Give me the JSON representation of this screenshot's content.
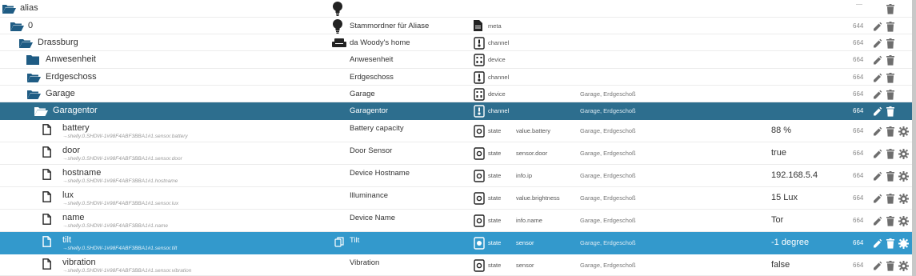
{
  "colors": {
    "selected_dark": "#2d6e8e",
    "selected_blue": "#3399cc",
    "folder": "#1f5c84"
  },
  "rows": [
    {
      "id": "alias",
      "name": "alias",
      "type_icon": "",
      "indent": 0,
      "kind": "folder-open",
      "cname": "",
      "ctype": "",
      "ctype_icon": "",
      "role": "",
      "room": "",
      "value": "",
      "acl": "",
      "actions": [
        "dash",
        "delete"
      ],
      "show_bulb": true
    },
    {
      "id": "0",
      "name": "0",
      "indent": 1,
      "kind": "folder-open",
      "cname": "Stammordner für Aliase",
      "ctype": "meta",
      "ctype_icon": "document-icon",
      "role": "",
      "room": "",
      "value": "",
      "acl": "644",
      "actions": [
        "edit",
        "delete"
      ],
      "show_bulb": true
    },
    {
      "id": "drassburg",
      "name": "Drassburg",
      "indent": 2,
      "kind": "folder-open",
      "cname": "da Woody's home",
      "ctype": "channel",
      "ctype_icon": "channel-icon",
      "role": "",
      "room": "",
      "value": "",
      "acl": "664",
      "actions": [
        "edit",
        "delete"
      ],
      "show_sofa": true
    },
    {
      "id": "anwesenheit",
      "name": "Anwesenheit",
      "indent": 3,
      "kind": "folder",
      "cname": "Anwesenheit",
      "ctype": "device",
      "ctype_icon": "device-icon",
      "role": "",
      "room": "",
      "value": "",
      "acl": "664",
      "actions": [
        "edit",
        "delete"
      ]
    },
    {
      "id": "erdgeschoss",
      "name": "Erdgeschoss",
      "indent": 3,
      "kind": "folder-open",
      "cname": "Erdgeschoss",
      "ctype": "channel",
      "ctype_icon": "channel-icon",
      "role": "",
      "room": "",
      "value": "",
      "acl": "664",
      "actions": [
        "edit",
        "delete"
      ]
    },
    {
      "id": "garage",
      "name": "Garage",
      "indent": 4,
      "kind": "folder-open",
      "cname": "Garage",
      "ctype": "device",
      "ctype_icon": "device-icon",
      "role": "",
      "room": "Garage, Erdgeschoß",
      "value": "",
      "acl": "664",
      "actions": [
        "edit",
        "delete"
      ]
    },
    {
      "id": "garagentor",
      "name": "Garagentor",
      "indent": 5,
      "kind": "folder-open",
      "cname": "Garagentor",
      "ctype": "channel",
      "ctype_icon": "channel-icon",
      "role": "",
      "room": "Garage, Erdgeschoß",
      "value": "",
      "acl": "664",
      "actions": [
        "edit",
        "delete"
      ],
      "selected": "dark"
    },
    {
      "id": "battery",
      "name": "battery",
      "sub": "→shelly.0.SHDW-1#98F4ABF3BBA1#1.sensor.battery",
      "indent": 6,
      "kind": "file",
      "cname": "Battery capacity",
      "ctype": "state",
      "ctype_icon": "state-icon",
      "role": "value.battery",
      "room": "Garage, Erdgeschoß",
      "value": "88 %",
      "acl": "664",
      "actions": [
        "edit",
        "delete",
        "gear"
      ]
    },
    {
      "id": "door",
      "name": "door",
      "sub": "→shelly.0.SHDW-1#98F4ABF3BBA1#1.sensor.door",
      "indent": 6,
      "kind": "file",
      "cname": "Door Sensor",
      "ctype": "state",
      "ctype_icon": "state-icon",
      "role": "sensor.door",
      "room": "Garage, Erdgeschoß",
      "value": "true",
      "acl": "664",
      "actions": [
        "edit",
        "delete",
        "gear"
      ]
    },
    {
      "id": "hostname",
      "name": "hostname",
      "sub": "→shelly.0.SHDW-1#98F4ABF3BBA1#1.hostname",
      "indent": 6,
      "kind": "file",
      "cname": "Device Hostname",
      "ctype": "state",
      "ctype_icon": "state-icon",
      "role": "info.ip",
      "room": "Garage, Erdgeschoß",
      "value": "192.168.5.4",
      "acl": "664",
      "actions": [
        "edit",
        "delete",
        "gear"
      ]
    },
    {
      "id": "lux",
      "name": "lux",
      "sub": "→shelly.0.SHDW-1#98F4ABF3BBA1#1.sensor.lux",
      "indent": 6,
      "kind": "file",
      "cname": "Illuminance",
      "ctype": "state",
      "ctype_icon": "state-icon",
      "role": "value.brightness",
      "room": "Garage, Erdgeschoß",
      "value": "15 Lux",
      "acl": "664",
      "actions": [
        "edit",
        "delete",
        "gear"
      ]
    },
    {
      "id": "name",
      "name": "name",
      "sub": "→shelly.0.SHDW-1#98F4ABF3BBA1#1.name",
      "indent": 6,
      "kind": "file",
      "cname": "Device Name",
      "ctype": "state",
      "ctype_icon": "state-icon",
      "role": "info.name",
      "room": "Garage, Erdgeschoß",
      "value": "Tor",
      "acl": "664",
      "actions": [
        "edit",
        "delete",
        "gear"
      ]
    },
    {
      "id": "tilt",
      "name": "tilt",
      "sub": "→shelly.0.SHDW-1#98F4ABF3BBA1#1.sensor.tilt",
      "indent": 6,
      "kind": "file",
      "cname": "Tilt",
      "ctype": "state",
      "ctype_icon": "state-icon",
      "role": "sensor",
      "room": "Garage, Erdgeschoß",
      "value": "-1 degree",
      "acl": "664",
      "actions": [
        "edit",
        "delete",
        "gear"
      ],
      "selected": "blue",
      "show_copy": true
    },
    {
      "id": "vibration",
      "name": "vibration",
      "sub": "→shelly.0.SHDW-1#98F4ABF3BBA1#1.sensor.vibration",
      "indent": 6,
      "kind": "file",
      "cname": "Vibration",
      "ctype": "state",
      "ctype_icon": "state-icon",
      "role": "sensor",
      "room": "Garage, Erdgeschoß",
      "value": "false",
      "acl": "664",
      "actions": [
        "edit",
        "delete",
        "gear"
      ]
    }
  ]
}
